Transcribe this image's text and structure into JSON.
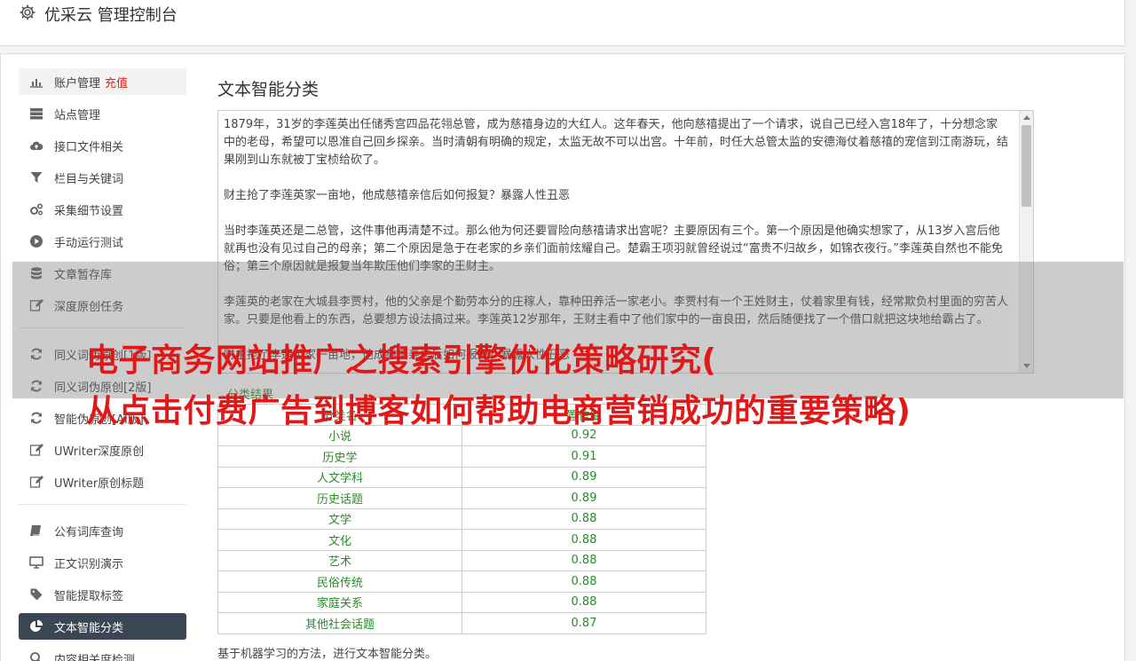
{
  "header": {
    "app_title": "优采云 管理控制台"
  },
  "sidebar": {
    "group1": [
      {
        "label": "账户管理",
        "extra": "充值",
        "icon": "bar-chart-icon"
      },
      {
        "label": "站点管理",
        "icon": "server-icon"
      },
      {
        "label": "接口文件相关",
        "icon": "cloud-upload-icon"
      },
      {
        "label": "栏目与关键词",
        "icon": "filter-icon"
      },
      {
        "label": "采集细节设置",
        "icon": "gears-icon"
      },
      {
        "label": "手动运行测试",
        "icon": "play-circle-icon"
      },
      {
        "label": "文章暂存库",
        "icon": "database-icon"
      },
      {
        "label": "深度原创任务",
        "icon": "edit-icon"
      }
    ],
    "group2": [
      {
        "label": "同义词伪原创[1版]",
        "icon": "refresh-icon"
      },
      {
        "label": "同义词伪原创[2版]",
        "icon": "refresh-icon"
      },
      {
        "label": "智能伪原创[AI版]",
        "icon": "refresh-icon"
      },
      {
        "label": "UWriter深度原创",
        "icon": "edit-icon"
      },
      {
        "label": "UWriter原创标题",
        "icon": "edit-icon"
      }
    ],
    "group3": [
      {
        "label": "公有词库查询",
        "icon": "book-icon"
      },
      {
        "label": "正文识别演示",
        "icon": "monitor-icon"
      },
      {
        "label": "智能提取标签",
        "icon": "tag-icon"
      },
      {
        "label": "文本智能分类",
        "icon": "pie-chart-icon"
      },
      {
        "label": "内容相关度检测",
        "icon": "search-icon"
      }
    ]
  },
  "main": {
    "title": "文本智能分类",
    "textarea_value": "1879年，31岁的李莲英出任储秀宫四品花翎总管，成为慈禧身边的大红人。这年春天，他向慈禧提出了一个请求，说自己已经入宫18年了，十分想念家中的老母，希望可以恩准自己回乡探亲。当时清朝有明确的规定，太监无故不可以出宫。十年前，时任大总管太监的安德海仗着慈禧的宠信到江南游玩，结果刚到山东就被丁宝桢给砍了。\n\n财主抢了李莲英家一亩地，他成慈禧亲信后如何报复？暴露人性丑恶\n\n当时李莲英还是二总管，这件事他再清楚不过。那么他为何还要冒险向慈禧请求出宫呢？主要原因有三个。第一个原因是他确实想家了，从13岁入宫后他就再也没有见过自己的母亲；第二个原因是急于在老家的乡亲们面前炫耀自己。楚霸王项羽就曾经说过“富贵不归故乡，如锦衣夜行。”李莲英自然也不能免俗；第三个原因就是报复当年欺压他们李家的王财主。\n\n李莲英的老家在大城县李贾村，他的父亲是个勤劳本分的庄稼人，靠种田养活一家老小。李贾村有一个王姓财主，仗着家里有钱，经常欺负村里面的穷苦人家。只要是他看上的东西，总要想方设法搞过来。李莲英12岁那年，王财主看中了他们家中的一亩良田，然后随便找了一个借口就把这块地给霸占了。\n\n财主抢了李莲英家一亩地，他成慈禧亲信后如何报复？暴露人性丑恶",
    "result_label": "分类结果",
    "table_headers": [
      "分类名",
      "置信度"
    ],
    "rows": [
      [
        "小说",
        "0.92"
      ],
      [
        "历史学",
        "0.91"
      ],
      [
        "人文学科",
        "0.89"
      ],
      [
        "历史话题",
        "0.89"
      ],
      [
        "文学",
        "0.88"
      ],
      [
        "文化",
        "0.88"
      ],
      [
        "艺术",
        "0.88"
      ],
      [
        "民俗传统",
        "0.88"
      ],
      [
        "家庭关系",
        "0.88"
      ],
      [
        "其他社会话题",
        "0.87"
      ]
    ],
    "footnote": "基于机器学习的方法，进行文本智能分类。"
  },
  "overlay": {
    "line1": "电子商务网站推广之搜索引擎优化策略研究(",
    "line2": "从点击付费广告到博客如何帮助电商营销成功的重要策略)"
  }
}
